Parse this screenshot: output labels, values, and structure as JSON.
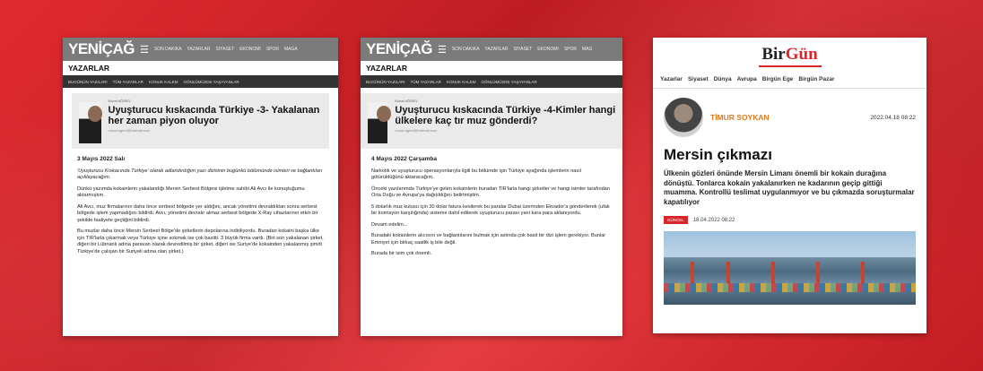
{
  "card1": {
    "logo": "YENİÇAĞ",
    "nav": [
      "SON DAKİKA",
      "YAZARLAR",
      "SİYASET",
      "EKONOMİ",
      "SPOR",
      "MAGA"
    ],
    "section_title": "YAZARLAR",
    "tabs": [
      "BUGÜNÜN YAZILARI",
      "TÜM YAZARLAR",
      "KONUK KALEM",
      "GÖNLÜMÜZDE YAŞAYANLAR"
    ],
    "author": "Murat AĞIREL",
    "headline": "Uyuşturucu kıskacında Türkiye -3- Yakalanan her zaman piyon oluyor",
    "email": "murat.agirel@hotmail.com",
    "date": "3 Mayıs 2022 Salı",
    "paragraphs": [
      "'Uyuşturucu Kıskacında Türkiye' olarak adlandırdığım yazı dizisinin bugünkü bölümünde isimleri ve bağlantıları açıklayacağım.",
      "Dünkü yazımda kokainlerin yakalandığı Mersin Serbest Bölgesi işletme sahibi Ali Avcı ile konuştuğumu aktarmıştım.",
      "Ali Avcı, muz firmalarının daha önce serbest bölgede yer aldığını, ancak yönetimi devraldıktan sonra serbest bölgede işlem yapmadığını bildirdi. Avcı, yönetimi devralır almaz serbest bölgede X-Ray cihazlarının etkin bir şekilde faaliyete geçtiğini bildirdi.",
      "Bu muzlar daha önce Mersin Serbest Bölge'de şirketlerin depolarına indiriliyordu. Buradan kokaini başka ülke için TIR'larla çıkarmak veya Türkiye içine sokmak ise çok basitti. 3 büyük firma vardı. (Biri son yakalanan şirket, diğeri bir Lübnanlı adına paravan olarak devredilmiş bir şirket, diğeri ise Suriye'de kokainden yakalanmış şimdi Türkiye'de çalışan bir Suriyeli adına olan şirket.)"
    ]
  },
  "card2": {
    "logo": "YENİÇAĞ",
    "nav": [
      "SON DAKİKA",
      "YAZARLAR",
      "SİYASET",
      "EKONOMİ",
      "SPOR",
      "MAG"
    ],
    "section_title": "YAZARLAR",
    "tabs": [
      "BUGÜNÜN YAZILARI",
      "TÜM YAZARLAR",
      "KONUK KALEM",
      "GÖNLÜMÜZDE YAŞAYANLAR"
    ],
    "author": "Murat AĞIREL",
    "headline": "Uyuşturucu kıskacında Türkiye -4-Kimler hangi ülkelere kaç tır muz gönderdi?",
    "email": "murat.agirel@hotmail.com",
    "date": "4 Mayıs 2022 Çarşamba",
    "paragraphs": [
      "Narkotik ve uyuşturucu operasyonlarıyla ilgili bu bölümde işin Türkiye ayağında işlemlerin nasıl götürüldüğünü aktaracağım.",
      "Önceki yazılarımda Türkiye'ye gelen kokainlerin buradan TIR'larla hangi şirketler ve hangi isimler tarafından Orta Doğu ve Avrupa'ya dağıtıldığını belirtmiştim.",
      "5 dolarlık muz kutusu için 30 dolar fatura kesilerek bu paralar Dubai üzerinden Ekvador'a gönderilerek (ufak bir komisyon karşılığında) sisteme dahil edilerek uyuşturucu parası yani kara para aklanıyordu.",
      "Devam edelim...",
      "Buradaki kokainlerin alıcısını ve bağlantılarını bulmak için aslında çok basit bir dizi işlem gerekiyor. Bunlar Emniyet için birkaç saatlik iş bile değil.",
      "Burada bir isim çok önemli."
    ]
  },
  "card3": {
    "logo_a": "Bir",
    "logo_b": "Gün",
    "nav": [
      "Yazarlar",
      "Siyaset",
      "Dünya",
      "Avrupa",
      "Birgün Ege",
      "Birgün Pazar"
    ],
    "author": "TİMUR SOYKAN",
    "date": "2022.04.18 08:22",
    "title": "Mersin çıkmazı",
    "subtitle": "Ülkenin gözleri önünde Mersin Limanı önemli bir kokain durağına dönüştü. Tonlarca kokain yakalanırken ne kadarının geçip gittiği muamma. Kontrollü teslimat uygulanmıyor ve bu çıkmazda soruşturmalar kapatılıyor",
    "tag": "GÜNCEL",
    "tag_date": "18.04.2022 08:22"
  }
}
